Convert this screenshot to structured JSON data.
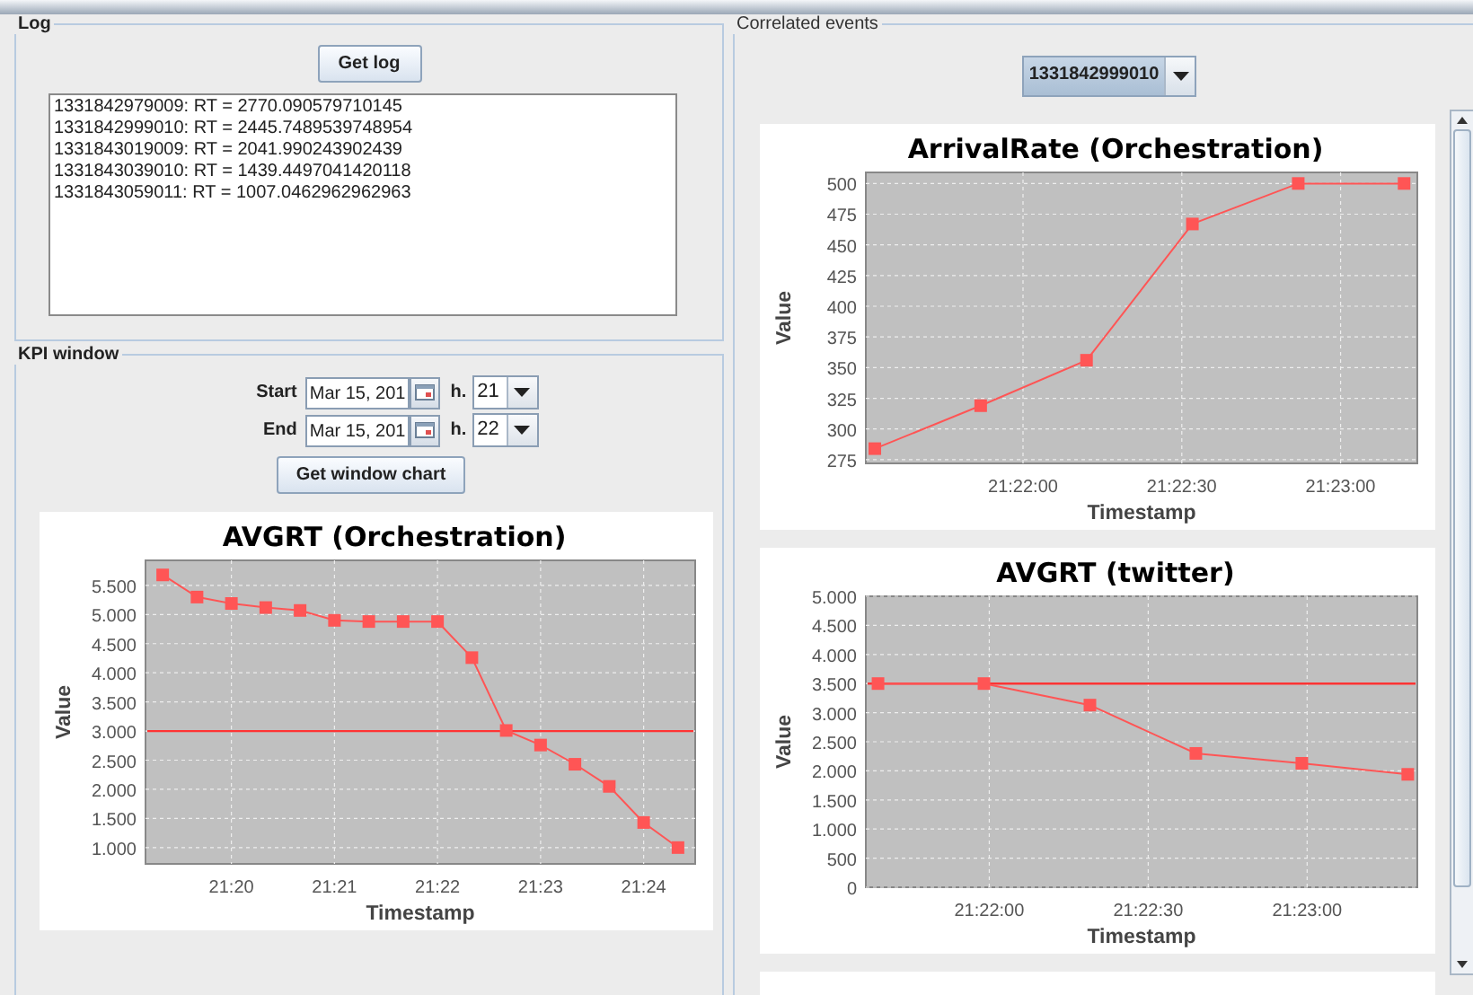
{
  "log": {
    "title": "Log",
    "button": "Get log",
    "lines": [
      "1331842979009: RT = 2770.090579710145",
      "1331842999010: RT = 2445.7489539748954",
      "1331843019009: RT = 2041.990243902439",
      "1331843039010: RT = 1439.4497041420118",
      "1331843059011: RT = 1007.0462962962963"
    ]
  },
  "kpi_window": {
    "title": "KPI window",
    "start": {
      "label": "Start",
      "date": "Mar 15, 201",
      "hour_label": "h.",
      "hour": "21"
    },
    "end": {
      "label": "End",
      "date": "Mar 15, 201",
      "hour_label": "h.",
      "hour": "22"
    },
    "button": "Get window chart",
    "chart_data": {
      "type": "line",
      "title": "AVGRT (Orchestration)",
      "xlabel": "Timestamp",
      "ylabel": "Value",
      "categories": [
        null,
        null,
        "21:20",
        null,
        null,
        "21:21",
        null,
        null,
        "21:22",
        null,
        null,
        "21:23",
        null,
        null,
        "21:24",
        null
      ],
      "grid": true,
      "series": [
        {
          "color": "#ff5555",
          "marker": "square",
          "values": [
            5680,
            5300,
            5190,
            5120,
            5070,
            4900,
            4880,
            4880,
            4880,
            4260,
            3010,
            2760,
            2430,
            2050,
            1430,
            1000
          ]
        }
      ],
      "ylim": [
        720,
        5930
      ],
      "yticks": [
        {
          "value": 1000,
          "label": "1.000"
        },
        {
          "value": 1500,
          "label": "1.500"
        },
        {
          "value": 2000,
          "label": "2.000"
        },
        {
          "value": 2500,
          "label": "2.500"
        },
        {
          "value": 3000,
          "label": "3.000"
        },
        {
          "value": 3500,
          "label": "3.500"
        },
        {
          "value": 4000,
          "label": "4.000"
        },
        {
          "value": 4500,
          "label": "4.500"
        },
        {
          "value": 5000,
          "label": "5.000"
        },
        {
          "value": 5500,
          "label": "5.500"
        }
      ],
      "ref_lines": [
        {
          "axis": "y",
          "value": 3000
        }
      ]
    }
  },
  "correlated_events": {
    "title": "Correlated events",
    "selector": "1331842999010",
    "charts": [
      {
        "chart_data": {
          "type": "line",
          "title": "ArrivalRate (Orchestration)",
          "xlabel": "Timestamp",
          "ylabel": "Value",
          "x": [
            76892,
            76912,
            76932,
            76952,
            76972,
            76992
          ],
          "grid": true,
          "series": [
            {
              "color": "#ff5555",
              "marker": "square",
              "values": [
                284,
                319,
                356,
                467,
                500,
                500
              ]
            }
          ],
          "xlim": [
            76890.3,
            76994.5
          ],
          "ylim": [
            272,
            509
          ],
          "xticks": [
            {
              "value": 76920,
              "label": "21:22:00"
            },
            {
              "value": 76950,
              "label": "21:22:30"
            },
            {
              "value": 76980,
              "label": "21:23:00"
            }
          ],
          "yticks": [
            {
              "value": 275,
              "label": "275"
            },
            {
              "value": 300,
              "label": "300"
            },
            {
              "value": 325,
              "label": "325"
            },
            {
              "value": 350,
              "label": "350"
            },
            {
              "value": 375,
              "label": "375"
            },
            {
              "value": 400,
              "label": "400"
            },
            {
              "value": 425,
              "label": "425"
            },
            {
              "value": 450,
              "label": "450"
            },
            {
              "value": 475,
              "label": "475"
            },
            {
              "value": 500,
              "label": "500"
            }
          ]
        }
      },
      {
        "chart_data": {
          "type": "line",
          "title": "AVGRT (twitter)",
          "xlabel": "Timestamp",
          "ylabel": "Value",
          "x": [
            76899,
            76919,
            76939,
            76959,
            76979,
            76999
          ],
          "grid": true,
          "series": [
            {
              "color": "#ff5555",
              "marker": "square",
              "values": [
                3500,
                3500,
                3130,
                2300,
                2130,
                1940
              ]
            }
          ],
          "xlim": [
            76896.7,
            77000.8
          ],
          "ylim": [
            0,
            5000
          ],
          "xticks": [
            {
              "value": 76920,
              "label": "21:22:00"
            },
            {
              "value": 76950,
              "label": "21:22:30"
            },
            {
              "value": 76980,
              "label": "21:23:00"
            }
          ],
          "yticks": [
            {
              "value": 0,
              "label": "0"
            },
            {
              "value": 500,
              "label": "500"
            },
            {
              "value": 1000,
              "label": "1.000"
            },
            {
              "value": 1500,
              "label": "1.500"
            },
            {
              "value": 2000,
              "label": "2.000"
            },
            {
              "value": 2500,
              "label": "2.500"
            },
            {
              "value": 3000,
              "label": "3.000"
            },
            {
              "value": 3500,
              "label": "3.500"
            },
            {
              "value": 4000,
              "label": "4.000"
            },
            {
              "value": 4500,
              "label": "4.500"
            },
            {
              "value": 5000,
              "label": "5.000"
            }
          ],
          "ref_lines": [
            {
              "axis": "y",
              "value": 3500
            }
          ]
        }
      }
    ]
  }
}
